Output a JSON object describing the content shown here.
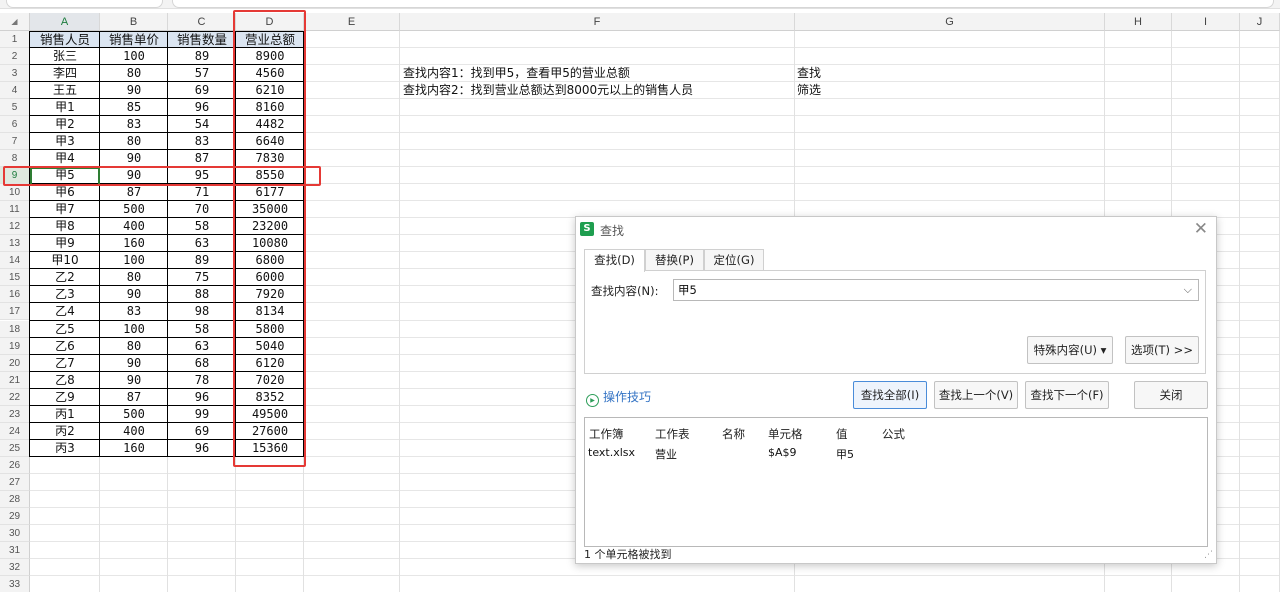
{
  "columns": [
    "A",
    "B",
    "C",
    "D",
    "E",
    "F",
    "G",
    "H",
    "I",
    "J"
  ],
  "row_numbers": [
    "1",
    "2",
    "3",
    "4",
    "5",
    "6",
    "7",
    "8",
    "9",
    "10",
    "11",
    "12",
    "13",
    "14",
    "15",
    "16",
    "17",
    "18",
    "19",
    "20",
    "21",
    "22",
    "23",
    "24",
    "25",
    "26",
    "27",
    "28",
    "29",
    "30",
    "31",
    "32",
    "33"
  ],
  "table": {
    "headers": [
      "销售人员",
      "销售单价",
      "销售数量",
      "营业总额"
    ],
    "rows": [
      [
        "张三",
        "100",
        "89",
        "8900"
      ],
      [
        "李四",
        "80",
        "57",
        "4560"
      ],
      [
        "王五",
        "90",
        "69",
        "6210"
      ],
      [
        "甲1",
        "85",
        "96",
        "8160"
      ],
      [
        "甲2",
        "83",
        "54",
        "4482"
      ],
      [
        "甲3",
        "80",
        "83",
        "6640"
      ],
      [
        "甲4",
        "90",
        "87",
        "7830"
      ],
      [
        "甲5",
        "90",
        "95",
        "8550"
      ],
      [
        "甲6",
        "87",
        "71",
        "6177"
      ],
      [
        "甲7",
        "500",
        "70",
        "35000"
      ],
      [
        "甲8",
        "400",
        "58",
        "23200"
      ],
      [
        "甲9",
        "160",
        "63",
        "10080"
      ],
      [
        "甲10",
        "100",
        "89",
        "6800"
      ],
      [
        "乙2",
        "80",
        "75",
        "6000"
      ],
      [
        "乙3",
        "90",
        "88",
        "7920"
      ],
      [
        "乙4",
        "83",
        "98",
        "8134"
      ],
      [
        "乙5",
        "100",
        "58",
        "5800"
      ],
      [
        "乙6",
        "80",
        "63",
        "5040"
      ],
      [
        "乙7",
        "90",
        "68",
        "6120"
      ],
      [
        "乙8",
        "90",
        "78",
        "7020"
      ],
      [
        "乙9",
        "87",
        "96",
        "8352"
      ],
      [
        "丙1",
        "500",
        "99",
        "49500"
      ],
      [
        "丙2",
        "400",
        "69",
        "27600"
      ],
      [
        "丙3",
        "160",
        "96",
        "15360"
      ]
    ]
  },
  "notes": [
    {
      "text": "查找内容1：找到甲5，查看甲5的营业总额",
      "tag": "查找"
    },
    {
      "text": "查找内容2：找到营业总额达到8000元以上的销售人员",
      "tag": "筛选"
    }
  ],
  "selected_cell": "A9",
  "dialog": {
    "app_logo": "S",
    "title": "查找",
    "tabs": [
      "查找(D)",
      "替换(P)",
      "定位(G)"
    ],
    "find_label": "查找内容(N):",
    "find_value": "甲5",
    "special_content": "特殊内容(U) ▾",
    "options": "选项(T) >>",
    "tips": "操作技巧",
    "find_all": "查找全部(I)",
    "find_prev": "查找上一个(V)",
    "find_next": "查找下一个(F)",
    "close_label": "关闭",
    "result_headers": [
      "工作簿",
      "工作表",
      "名称",
      "单元格",
      "值",
      "公式"
    ],
    "results": [
      {
        "workbook": "text.xlsx",
        "sheet": "营业",
        "name": "",
        "cell": "$A$9",
        "value": "甲5",
        "formula": ""
      }
    ],
    "status": "1 个单元格被找到"
  },
  "colors": {
    "highlight_red": "#e53935",
    "header_fill": "#dbe5f1",
    "select_green": "#2e7d32"
  }
}
